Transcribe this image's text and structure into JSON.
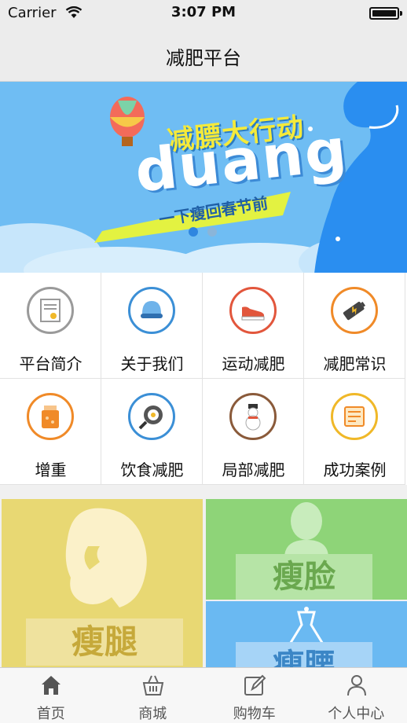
{
  "status_bar": {
    "carrier": "Carrier",
    "time": "3:07 PM"
  },
  "nav": {
    "title": "减肥平台"
  },
  "banner": {
    "line1": "减膘大行动",
    "line2": "duang",
    "line3": "一下瘦回春节前",
    "dots_count": 2,
    "active_dot": 0
  },
  "grid": {
    "items": [
      {
        "label": "平台简介",
        "icon": "certificate-icon",
        "color": "#9a9a9a"
      },
      {
        "label": "关于我们",
        "icon": "cap-icon",
        "color": "#3b8fd6"
      },
      {
        "label": "运动减肥",
        "icon": "sneaker-icon",
        "color": "#e2563c"
      },
      {
        "label": "减肥常识",
        "icon": "battery-icon",
        "color": "#f08a28"
      },
      {
        "label": "增重",
        "icon": "jar-icon",
        "color": "#f08a28"
      },
      {
        "label": "饮食减肥",
        "icon": "frying-pan-icon",
        "color": "#3b8fd6"
      },
      {
        "label": "局部减肥",
        "icon": "snowman-icon",
        "color": "#8a5a3a"
      },
      {
        "label": "成功案例",
        "icon": "document-icon",
        "color": "#f0b828"
      }
    ]
  },
  "tiles": {
    "legs": "瘦腿",
    "face": "瘦脸",
    "waist": "瘦腰"
  },
  "tab_bar": {
    "items": [
      {
        "label": "首页",
        "icon": "home-icon",
        "active": true
      },
      {
        "label": "商城",
        "icon": "basket-icon",
        "active": false
      },
      {
        "label": "购物车",
        "icon": "edit-icon",
        "active": false
      },
      {
        "label": "个人中心",
        "icon": "person-icon",
        "active": false
      }
    ]
  }
}
